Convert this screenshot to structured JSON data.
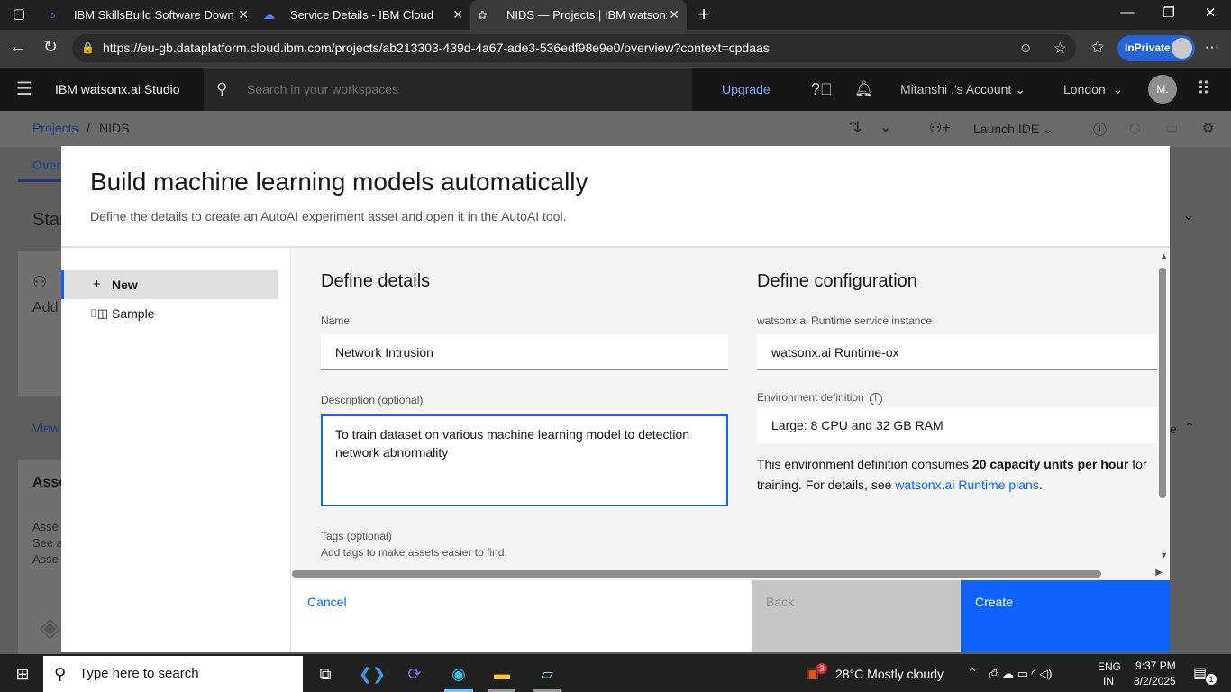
{
  "browser": {
    "tabs": [
      {
        "title": "IBM SkillsBuild Software Downloa",
        "close": "✕"
      },
      {
        "title": "Service Details - IBM Cloud",
        "close": "✕"
      },
      {
        "title": "NIDS — Projects | IBM watsonx.ai",
        "close": "✕"
      }
    ],
    "new_tab": "+",
    "url": "https://eu-gb.dataplatform.cloud.ibm.com/projects/ab213303-439d-4a67-ade3-536edf98e9e0/overview?context=cpdaas",
    "inprivate": "InPrivate"
  },
  "header": {
    "product": "IBM watsonx.ai Studio",
    "search_placeholder": "Search in your workspaces",
    "upgrade": "Upgrade",
    "account": "Mitanshi .'s Account",
    "region": "London",
    "avatar": "M."
  },
  "project": {
    "breadcrumb_root": "Projects",
    "breadcrumb_sep": "/",
    "breadcrumb_current": "NIDS",
    "launch_ide": "Launch IDE",
    "bg_tab": "Over",
    "bg_start": "Star",
    "bg_add": "Add",
    "bg_view": "View",
    "bg_assets": "Asse",
    "bg_lines": [
      "Asse",
      "See a",
      "Asse"
    ],
    "bg_e": "e"
  },
  "modal": {
    "title": "Build machine learning models automatically",
    "subtitle": "Define the details to create an AutoAI experiment asset and open it in the AutoAI tool.",
    "nav": [
      {
        "icon": "+",
        "label": "New"
      },
      {
        "icon": "⌷◫",
        "label": "Sample"
      }
    ],
    "details": {
      "heading": "Define details",
      "name_label": "Name",
      "name_value": "Network Intrusion",
      "desc_label": "Description (optional)",
      "desc_value": "To train dataset on various machine learning model to detection network abnormality",
      "tags_label": "Tags (optional)",
      "tags_hint": "Add tags to make assets easier to find."
    },
    "config": {
      "heading": "Define configuration",
      "runtime_label": "watsonx.ai Runtime service instance",
      "runtime_value": "watsonx.ai Runtime-ox",
      "env_label": "Environment definition",
      "env_value": "Large: 8 CPU and 32 GB RAM",
      "consumes_pre": "This environment definition consumes ",
      "consumes_bold": "20 capacity units per hour",
      "consumes_post": " for training. For details, see ",
      "consumes_link": "watsonx.ai Runtime plans",
      "consumes_end": "."
    },
    "footer": {
      "cancel": "Cancel",
      "back": "Back",
      "create": "Create"
    }
  },
  "taskbar": {
    "search_placeholder": "Type here to search",
    "weather_badge": "3",
    "weather": "28°C  Mostly cloudy",
    "lang1": "ENG",
    "lang2": "IN",
    "time": "9:37 PM",
    "date": "8/2/2025",
    "notif_badge": "1"
  },
  "colors": {
    "primary": "#0f62fe",
    "disabled": "#c6c6c6",
    "header": "#161616"
  }
}
